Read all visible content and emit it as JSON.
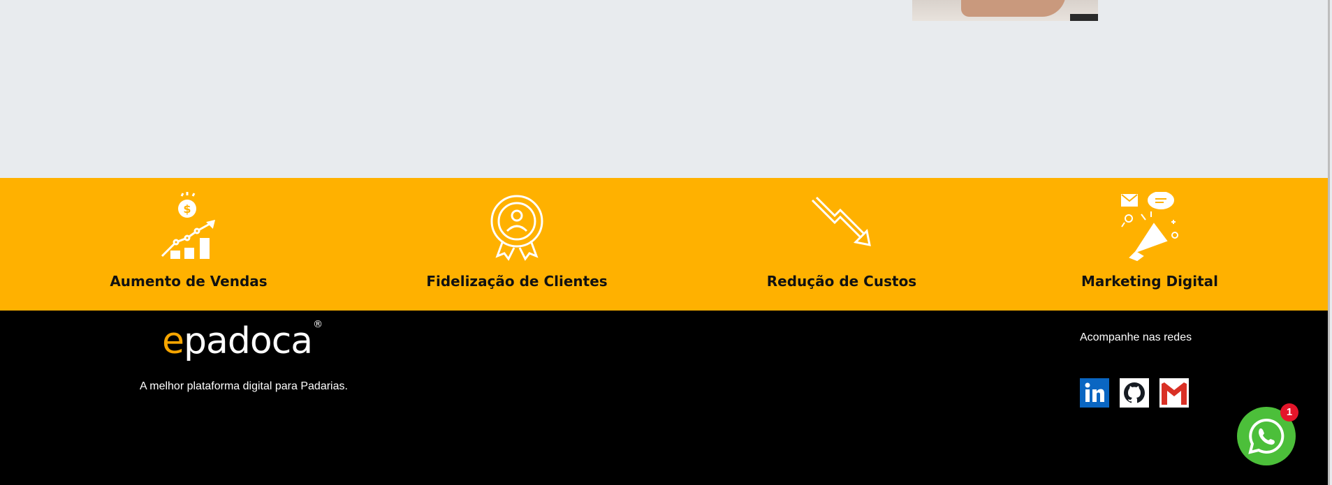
{
  "features": [
    {
      "label": "Aumento de Vendas",
      "icon": "sales-growth-icon"
    },
    {
      "label": "Fidelização de Clientes",
      "icon": "customer-badge-icon"
    },
    {
      "label": "Redução de Custos",
      "icon": "cost-down-arrow-icon"
    },
    {
      "label": "Marketing Digital",
      "icon": "megaphone-icon"
    }
  ],
  "footer": {
    "logo_e": "e",
    "logo_rest": "padoca",
    "logo_reg": "®",
    "tagline": "A melhor plataforma digital para Padarias.",
    "follow_label": "Acompanhe nas redes",
    "socials": [
      "linkedin-icon",
      "github-icon",
      "gmail-icon"
    ]
  },
  "whatsapp": {
    "badge_count": "1"
  },
  "colors": {
    "accent": "#ffb100",
    "footer_bg": "#000000",
    "logo_e": "#f6a500",
    "whatsapp": "#4cbf3a",
    "badge": "#e4152a"
  }
}
